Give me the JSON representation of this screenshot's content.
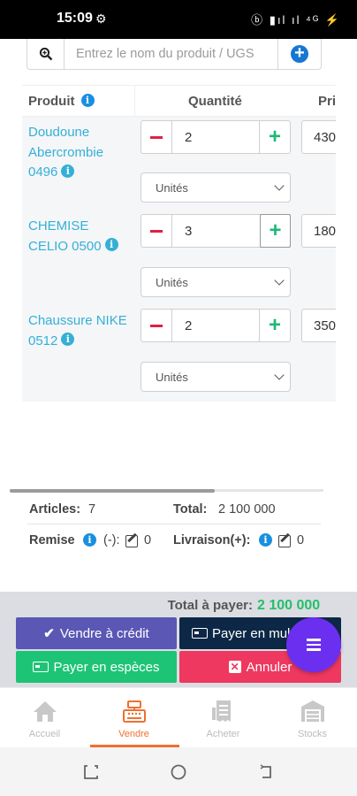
{
  "status_bar": {
    "time": "15:09",
    "gear": "⚙",
    "icons": "ⓑ ▮ıl ıl ⁴ᴳ ⚡"
  },
  "search": {
    "placeholder": "Entrez le nom du produit / UGS"
  },
  "table": {
    "headers": {
      "produit": "Produit",
      "quantite": "Quantité",
      "prix": "Pri"
    },
    "rows": [
      {
        "name": "Doudoune Abercrombie 0496",
        "quantity": "2",
        "price": "430",
        "unit": "Unités"
      },
      {
        "name": "CHEMISE CELIO 0500",
        "quantity": "3",
        "price": "180",
        "unit": "Unités"
      },
      {
        "name": "Chaussure NIKE 0512",
        "quantity": "2",
        "price": "350",
        "unit": "Unités"
      }
    ]
  },
  "summary": {
    "articles_label": "Articles:",
    "articles_value": "7",
    "total_label": "Total:",
    "total_value": "2 100 000",
    "remise_label": "Remise",
    "remise_sign": "(-):",
    "remise_value": "0",
    "livraison_label": "Livraison(+):",
    "livraison_value": "0"
  },
  "payment": {
    "total_label": "Total à payer:",
    "total_value": "2 100 000",
    "credit_label": "Vendre à crédit",
    "multi_label": "Payer en multi",
    "cash_label": "Payer en espèces",
    "cancel_label": "Annuler"
  },
  "nav": [
    {
      "label": "Accueil",
      "icon": "home-icon"
    },
    {
      "label": "Vendre",
      "icon": "cash-register-icon"
    },
    {
      "label": "Acheter",
      "icon": "receipt-icon"
    },
    {
      "label": "Stocks",
      "icon": "warehouse-icon"
    }
  ],
  "colors": {
    "accent_blue": "#1677d2",
    "product_link": "#34b0d6",
    "credit": "#5a57b5",
    "multi": "#0d2846",
    "cash": "#1ec476",
    "cancel": "#ee3860",
    "fab": "#6b2ff0",
    "nav_active": "#f07030",
    "total_green": "#22c06a"
  }
}
